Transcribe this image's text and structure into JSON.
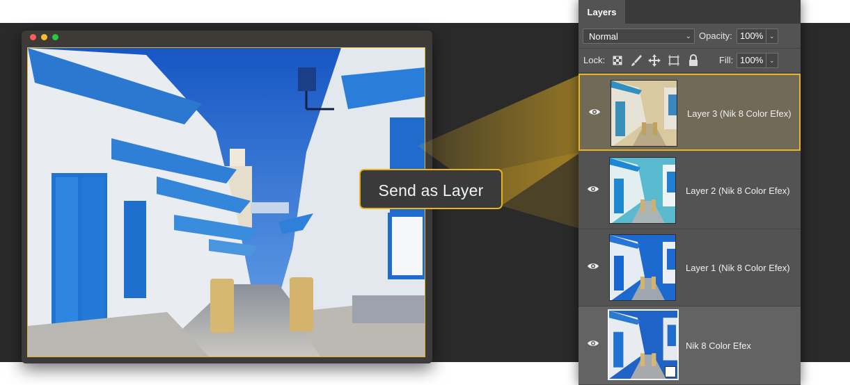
{
  "window": {
    "traffic_lights": [
      "close",
      "minimize",
      "zoom"
    ]
  },
  "callout": {
    "label": "Send as Layer",
    "accent": "#e8b421"
  },
  "layers_panel": {
    "tab_label": "Layers",
    "blend_mode": "Normal",
    "opacity_label": "Opacity:",
    "opacity_value": "100%",
    "lock_label": "Lock:",
    "lock_icons": [
      "lock-transparent-pixels-icon",
      "lock-image-pixels-icon",
      "lock-position-icon",
      "lock-artboard-icon",
      "lock-all-icon"
    ],
    "fill_label": "Fill:",
    "fill_value": "100%",
    "layers": [
      {
        "name": "Layer 3 (Nik 8 Color Efex)",
        "selected": true,
        "tone": "warm"
      },
      {
        "name": "Layer 2 (Nik 8 Color Efex)",
        "selected": false,
        "tone": "teal"
      },
      {
        "name": "Layer 1 (Nik 8 Color Efex)",
        "selected": false,
        "tone": "cool"
      },
      {
        "name": "Nik 8 Color Efex",
        "selected": false,
        "tone": "base",
        "smart_object": true
      }
    ]
  }
}
